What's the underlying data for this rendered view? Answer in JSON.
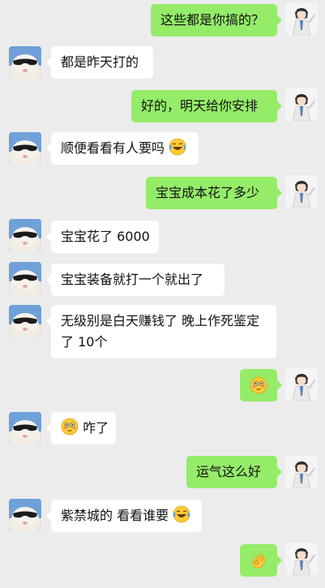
{
  "conversation": {
    "messages": [
      {
        "side": "right",
        "text": "这些都是你搞的？"
      },
      {
        "side": "left",
        "text": "都是昨天打的"
      },
      {
        "side": "right",
        "text": "好的，明天给你安排"
      },
      {
        "side": "left",
        "text": "顺便看看有人要吗",
        "emoji": "laughing-crying-emoji"
      },
      {
        "side": "right",
        "text": "宝宝成本花了多少"
      },
      {
        "side": "left",
        "text": "宝宝花了 6000"
      },
      {
        "side": "left",
        "text": "宝宝装备就打一个就出了"
      },
      {
        "side": "left",
        "text": "无级别是白天赚钱了  晚上作死鉴定了 10个"
      },
      {
        "side": "right",
        "emoji": "flushed-emoji"
      },
      {
        "side": "left",
        "text": "咋了",
        "leading_emoji": "flushed-emoji"
      },
      {
        "side": "right",
        "text": "运气这么好"
      },
      {
        "side": "left",
        "text": "紫禁城的 看看谁要",
        "emoji": "laughing-crying-emoji"
      },
      {
        "side": "right",
        "emoji": "ok-hand-emoji"
      }
    ]
  },
  "avatars": {
    "left": "sunglasses-hamster-avatar",
    "right": "cartoon-girl-avatar"
  },
  "colors": {
    "background": "#ececec",
    "bubble_sent": "#95ec69",
    "bubble_received": "#ffffff"
  }
}
